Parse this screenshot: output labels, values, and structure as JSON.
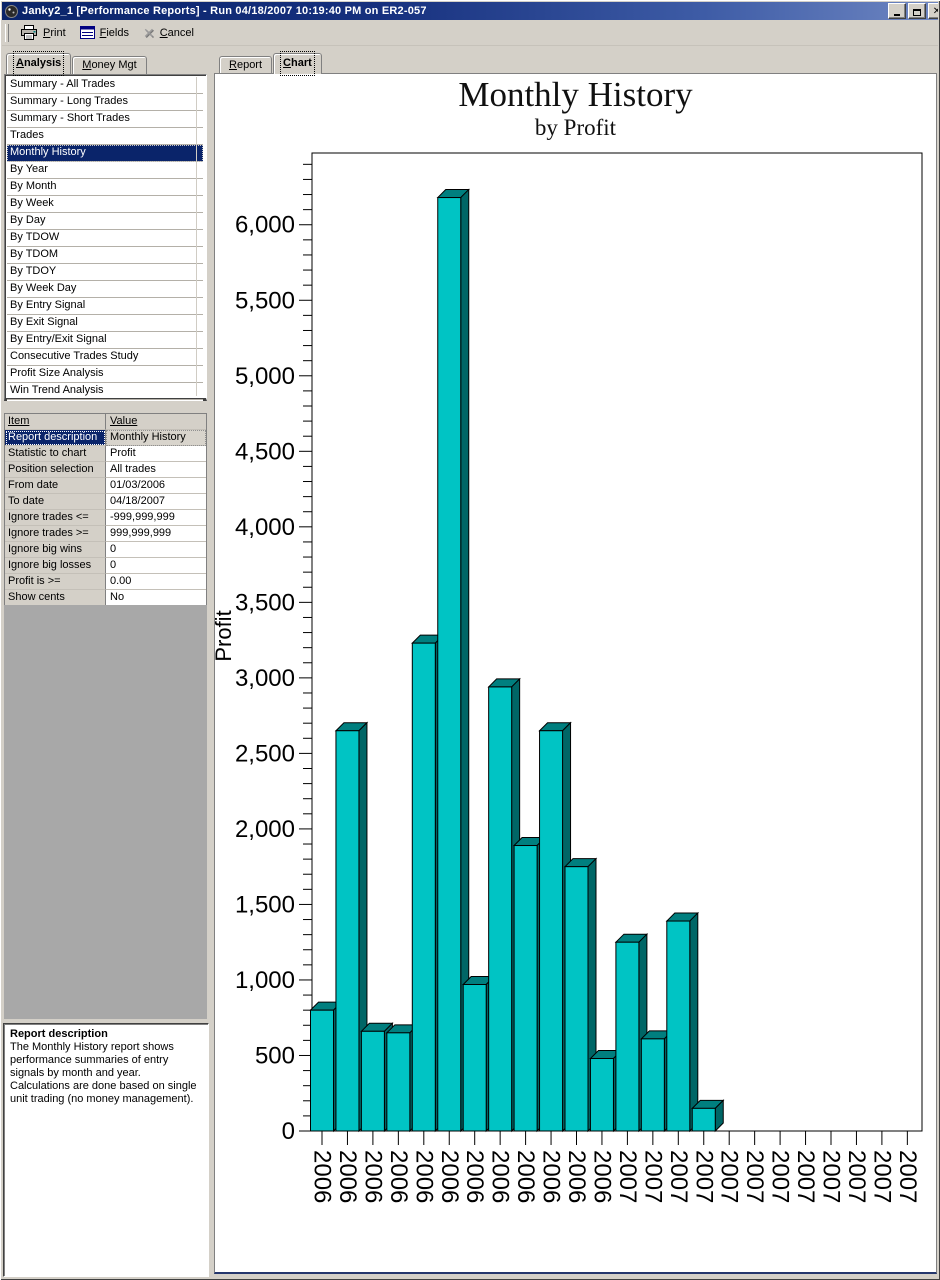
{
  "titlebar": {
    "title": "Janky2_1  [Performance Reports]  -  Run 04/18/2007 10:19:40 PM on ER2-057",
    "buttons": {
      "minimize": "minimize",
      "maximize": "maximize",
      "close": "✕"
    }
  },
  "toolbar": {
    "print_label": "Print",
    "fields_label": "Fields",
    "cancel_label": "Cancel"
  },
  "left_panel": {
    "tabs": [
      {
        "label": "Analysis",
        "active": true
      },
      {
        "label": "Money Mgt",
        "active": false
      }
    ],
    "reports": [
      "Summary - All Trades",
      "Summary - Long Trades",
      "Summary - Short Trades",
      "Trades",
      "Monthly History",
      "By Year",
      "By Month",
      "By Week",
      "By Day",
      "By TDOW",
      "By TDOM",
      "By TDOY",
      "By Week Day",
      "By Entry Signal",
      "By Exit Signal",
      "By Entry/Exit Signal",
      "Consecutive Trades Study",
      "Profit Size Analysis",
      "Win Trend Analysis"
    ],
    "selected_report": "Monthly History",
    "settings": {
      "headers": [
        "Item",
        "Value"
      ],
      "selected_row_index": 0,
      "rows": [
        [
          "Report description",
          "Monthly History"
        ],
        [
          "Statistic to chart",
          "Profit"
        ],
        [
          "Position selection",
          "All trades"
        ],
        [
          "From date",
          "01/03/2006"
        ],
        [
          "To date",
          "04/18/2007"
        ],
        [
          "Ignore trades <=",
          "-999,999,999"
        ],
        [
          "Ignore trades >=",
          "999,999,999"
        ],
        [
          "Ignore big wins",
          "0"
        ],
        [
          "Ignore big losses",
          "0"
        ],
        [
          "Profit is >=",
          "0.00"
        ],
        [
          "Show cents",
          "No"
        ]
      ]
    },
    "description": {
      "heading": "Report description",
      "body": "The Monthly History report shows performance summaries of entry signals by month and year.   Calculations are done based on single unit trading (no money management)."
    }
  },
  "right_panel": {
    "tabs": [
      {
        "label": "Report",
        "active": false
      },
      {
        "label": "Chart",
        "active": true
      }
    ]
  },
  "colors": {
    "selection": "#0A246A",
    "window_face": "#D4D0C8",
    "bar_front": "#00C4C4",
    "bar_side": "#006666",
    "bar_top": "#007F7F"
  },
  "chart_data": {
    "type": "bar",
    "title": "Monthly History",
    "subtitle": "by Profit",
    "ylabel": "Profit",
    "xlabel": "",
    "categories": [
      "2006",
      "2006",
      "2006",
      "2006",
      "2006",
      "2006",
      "2006",
      "2006",
      "2006",
      "2006",
      "2006",
      "2006",
      "2007",
      "2007",
      "2007",
      "2007",
      "2007",
      "2007",
      "2007",
      "2007",
      "2007",
      "2007",
      "2007",
      "2007"
    ],
    "values": [
      800,
      2650,
      660,
      650,
      3230,
      6180,
      970,
      2940,
      1890,
      2650,
      1750,
      480,
      1250,
      610,
      1390,
      150,
      0,
      0,
      0,
      0,
      0,
      0,
      0,
      0
    ],
    "ylim": [
      0,
      6475
    ],
    "ytick_step": 500,
    "ytick_max_label": 6000,
    "minor_tick_step": 100,
    "grid": false,
    "legend": false,
    "bar_front_color": "#00C4C4",
    "bar_side_color": "#006666",
    "bar_top_color": "#007F7F"
  }
}
